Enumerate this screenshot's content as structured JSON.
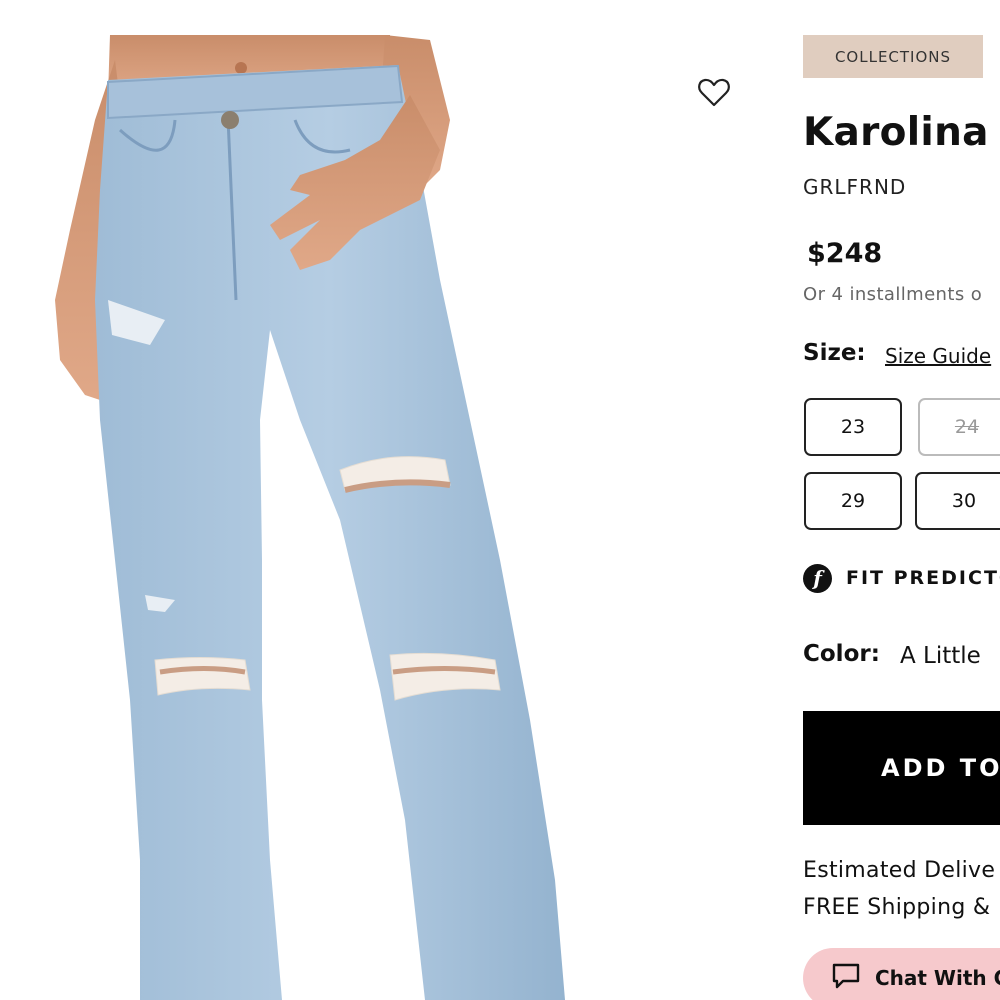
{
  "product": {
    "collection_label": "COLLECTIONS",
    "title": "Karolina I",
    "brand": "GRLFRND",
    "price": "$248",
    "installments_text": "Or 4 installments o"
  },
  "size": {
    "label": "Size:",
    "guide_link": "Size Guide",
    "options": [
      {
        "label": "23",
        "available": true
      },
      {
        "label": "24",
        "available": false
      },
      {
        "label": "29",
        "available": true
      },
      {
        "label": "30",
        "available": true
      }
    ]
  },
  "fit_predictor": {
    "label": "FIT PREDICTO",
    "icon": "f"
  },
  "color": {
    "label": "Color:",
    "value": "A Little"
  },
  "add_to_bag": {
    "label": "ADD TO"
  },
  "delivery": {
    "estimated": "Estimated Delive",
    "shipping": "FREE Shipping &"
  },
  "chat": {
    "label": "Chat With C"
  },
  "colors": {
    "collections_bg": "#e0cdbf",
    "chat_bg": "#f6c9cc",
    "cta_bg": "#000000",
    "denim": "#a9c4dc"
  }
}
